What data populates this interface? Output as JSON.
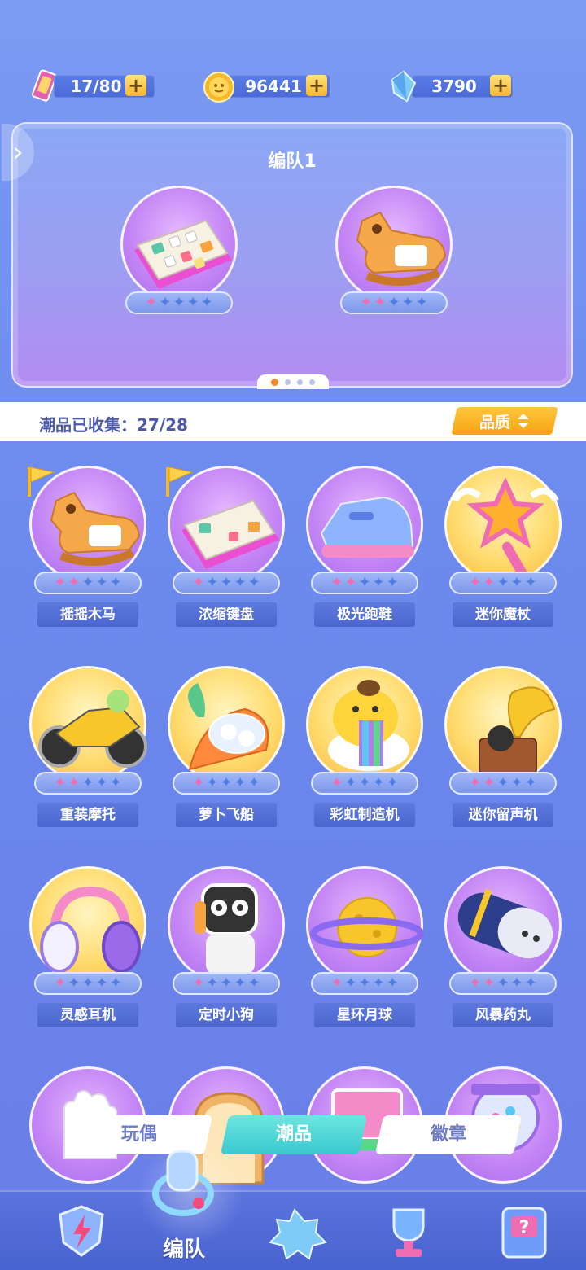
{
  "resources": {
    "stamina": {
      "value": "17/80",
      "icon": "ticket-icon"
    },
    "coins": {
      "value": "96441",
      "icon": "coin-icon"
    },
    "gems": {
      "value": "3790",
      "icon": "crystal-icon"
    }
  },
  "team": {
    "title": "编队1",
    "members": [
      {
        "icon": "keyboard-icon",
        "stars": 1,
        "color": "purple"
      },
      {
        "icon": "rocking-horse-icon",
        "stars": 2,
        "color": "purple"
      }
    ],
    "pages": 4,
    "current_page": 1
  },
  "collection": {
    "label": "潮品已收集：27/28",
    "quality_label": "品质"
  },
  "items": [
    {
      "name": "摇摇木马",
      "stars": 2,
      "bg": "purple",
      "icon": "rocking-horse-icon",
      "flag": true
    },
    {
      "name": "浓缩键盘",
      "stars": 1,
      "bg": "purple",
      "icon": "keyboard-icon",
      "flag": true
    },
    {
      "name": "极光跑鞋",
      "stars": 2,
      "bg": "purple",
      "icon": "sneaker-icon",
      "flag": false
    },
    {
      "name": "迷你魔杖",
      "stars": 2,
      "bg": "gold",
      "icon": "magic-wand-icon",
      "flag": false
    },
    {
      "name": "重装摩托",
      "stars": 2,
      "bg": "gold",
      "icon": "motorcycle-icon",
      "flag": false
    },
    {
      "name": "萝卜飞船",
      "stars": 1,
      "bg": "gold",
      "icon": "carrot-ship-icon",
      "flag": false
    },
    {
      "name": "彩虹制造机",
      "stars": 1,
      "bg": "gold",
      "icon": "rainbow-maker-icon",
      "flag": false
    },
    {
      "name": "迷你留声机",
      "stars": 2,
      "bg": "gold",
      "icon": "gramophone-icon",
      "flag": false
    },
    {
      "name": "灵感耳机",
      "stars": 1,
      "bg": "gold",
      "icon": "headphones-icon",
      "flag": false
    },
    {
      "name": "定时小狗",
      "stars": 1,
      "bg": "purple",
      "icon": "robot-dog-icon",
      "flag": false
    },
    {
      "name": "星环月球",
      "stars": 1,
      "bg": "purple",
      "icon": "ringed-planet-icon",
      "flag": false
    },
    {
      "name": "风暴药丸",
      "stars": 2,
      "bg": "purple",
      "icon": "pill-icon",
      "flag": false
    },
    {
      "name": "",
      "stars": 0,
      "bg": "purple",
      "icon": "glove-icon",
      "flag": false
    },
    {
      "name": "",
      "stars": 0,
      "bg": "purple",
      "icon": "toast-icon",
      "flag": false
    },
    {
      "name": "",
      "stars": 0,
      "bg": "purple",
      "icon": "card-icon",
      "flag": false
    },
    {
      "name": "",
      "stars": 0,
      "bg": "purple",
      "icon": "gumball-machine-icon",
      "flag": false
    }
  ],
  "category_tabs": [
    {
      "label": "玩偶",
      "active": false
    },
    {
      "label": "潮品",
      "active": true
    },
    {
      "label": "徽章",
      "active": false
    }
  ],
  "bottom_nav": {
    "active_label": "编队",
    "buttons": [
      {
        "icon": "shield-bolt-icon"
      },
      {
        "icon": "whistle-icon"
      },
      {
        "icon": "gamepad-icon"
      },
      {
        "icon": "trophy-icon"
      },
      {
        "icon": "mystery-machine-icon"
      }
    ]
  },
  "colors": {
    "star_on": "#f06cb2",
    "star_off": "#4f7de2",
    "accent": "#f7a416",
    "active_tab": "#39c9cf"
  }
}
